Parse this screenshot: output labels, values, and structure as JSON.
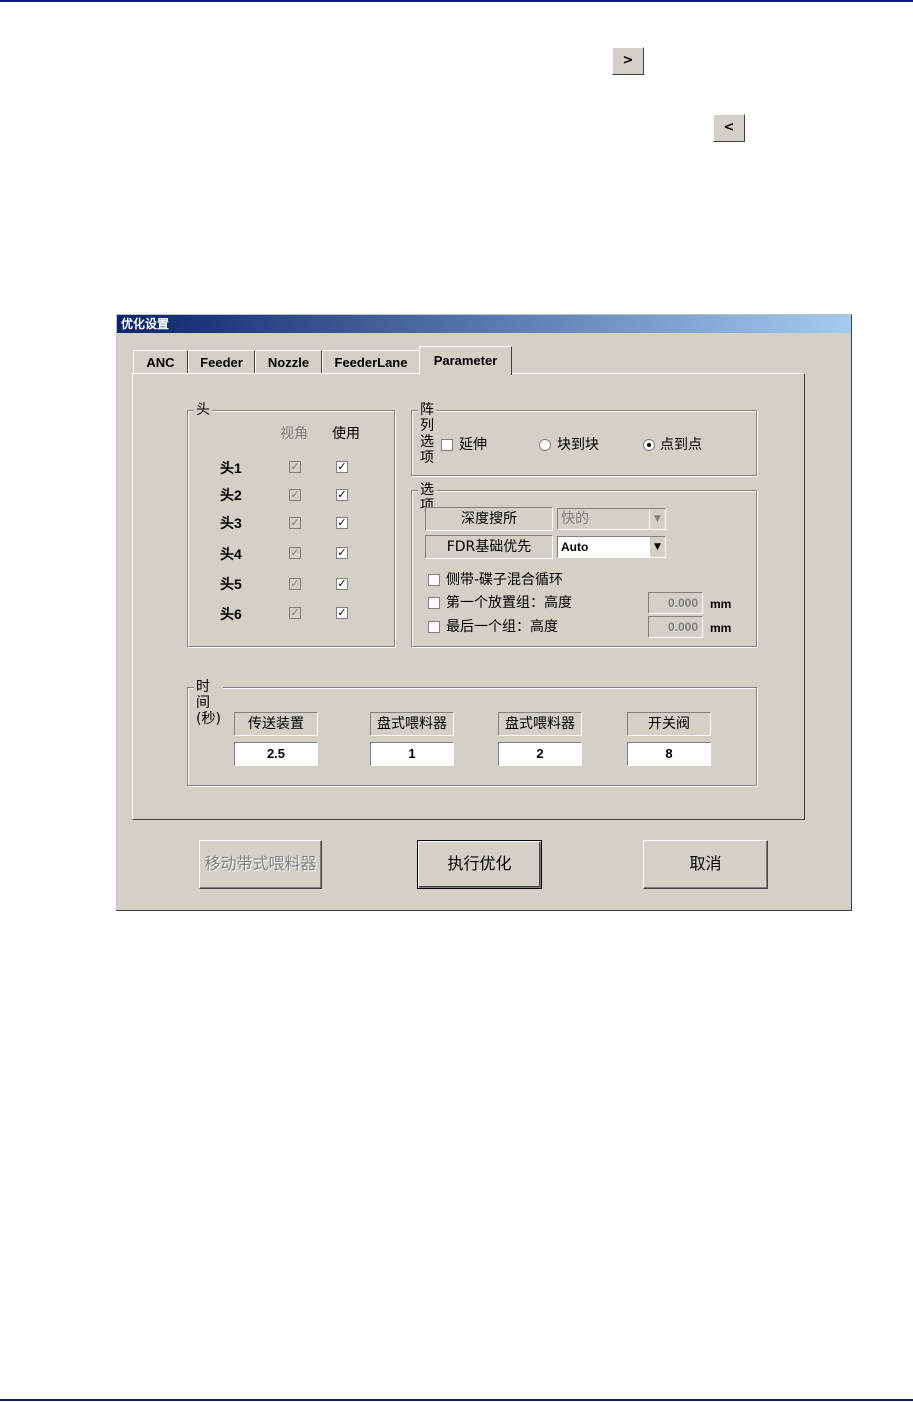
{
  "top_buttons": {
    "next": ">",
    "prev": "<"
  },
  "dialog": {
    "title": "优化设置",
    "tabs": [
      "ANC",
      "Feeder",
      "Nozzle",
      "FeederLane",
      "Parameter"
    ],
    "active_tab": "Parameter",
    "head_group": {
      "title": "头",
      "col_vision": "视角",
      "col_use": "使用",
      "heads": [
        {
          "label": "头1",
          "vision": true,
          "use": true
        },
        {
          "label": "头2",
          "vision": true,
          "use": true
        },
        {
          "label": "头3",
          "vision": true,
          "use": true
        },
        {
          "label": "头4",
          "vision": true,
          "use": true
        },
        {
          "label": "头5",
          "vision": true,
          "use": true
        },
        {
          "label": "头6",
          "vision": true,
          "use": true
        }
      ]
    },
    "array_group": {
      "title": "阵列选项",
      "extend_label": "延伸",
      "extend_checked": false,
      "block_label": "块到块",
      "point_label": "点到点",
      "selected": "点到点"
    },
    "options_group": {
      "title": "选项",
      "depth_label": "深度搜所",
      "depth_value": "快的",
      "fdr_label": "FDR基础优先",
      "fdr_value": "Auto",
      "mix_loop_label": "侧带-碟子混合循环",
      "first_group_label": "第一个放置组：高度",
      "first_group_value": "0.000",
      "last_group_label": "最后一个组：高度",
      "last_group_value": "0.000",
      "unit": "mm"
    },
    "time_group": {
      "title": "时间(秒)",
      "items": [
        {
          "label": "传送装置",
          "value": "2.5"
        },
        {
          "label": "盘式喂料器",
          "value": "1"
        },
        {
          "label": "盘式喂料器",
          "value": "2"
        },
        {
          "label": "开关阀",
          "value": "8"
        }
      ]
    },
    "buttons": {
      "move_feeder": "移动带式喂料器",
      "run": "执行优化",
      "cancel": "取消"
    }
  }
}
